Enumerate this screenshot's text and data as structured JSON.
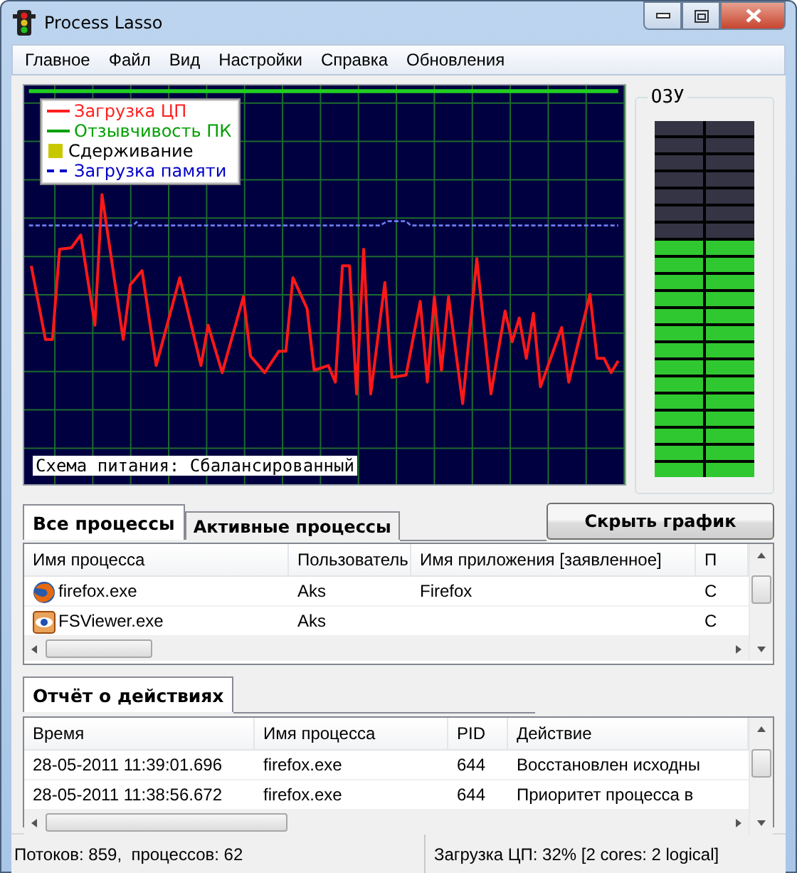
{
  "window": {
    "title": "Process Lasso"
  },
  "menu": [
    "Главное",
    "Файл",
    "Вид",
    "Настройки",
    "Справка",
    "Обновления"
  ],
  "graph": {
    "legend": [
      {
        "label": "Загрузка ЦП",
        "kind": "line",
        "color": "#ff2020"
      },
      {
        "label": "Отзывчивость ПК",
        "kind": "line",
        "color": "#00a000"
      },
      {
        "label": "Сдерживание",
        "kind": "square",
        "color": "#c8c800"
      },
      {
        "label": "Загрузка памяти",
        "kind": "dash",
        "color": "#0000c8"
      }
    ],
    "power_scheme": "Схема питания: Сбалансированный"
  },
  "ram_meter": {
    "label": "ОЗУ",
    "level": 0.67
  },
  "process_tabs": [
    {
      "label": "Все процессы",
      "selected": true
    },
    {
      "label": "Активные процессы",
      "selected": false
    }
  ],
  "hide_graph_button": "Скрыть график",
  "process_table": {
    "columns": [
      "Имя процесса",
      "Пользователь",
      "Имя приложения [заявленное]",
      "П"
    ],
    "rows": [
      {
        "kind": "browser",
        "cells": [
          "firefox.exe",
          "Aks",
          "Firefox",
          "С"
        ]
      },
      {
        "kind": "viewer",
        "cells": [
          "FSViewer.exe",
          "Aks",
          "",
          "С"
        ]
      }
    ]
  },
  "log_tabs": [
    {
      "label": "Отчёт о действиях",
      "selected": true
    }
  ],
  "log_table": {
    "columns": [
      "Время",
      "Имя процесса",
      "PID",
      "Действие"
    ],
    "rows": [
      {
        "cells": [
          "28-05-2011 11:39:01.696",
          "firefox.exe",
          "644",
          "Восстановлен исходны"
        ]
      },
      {
        "cells": [
          "28-05-2011 11:38:56.672",
          "firefox.exe",
          "644",
          "Приоритет процесса в"
        ]
      }
    ]
  },
  "status_bar": [
    "Потоков: 859,  процессов: 62",
    "Загрузка ЦП: 32% [2 cores: 2 logical]"
  ]
}
